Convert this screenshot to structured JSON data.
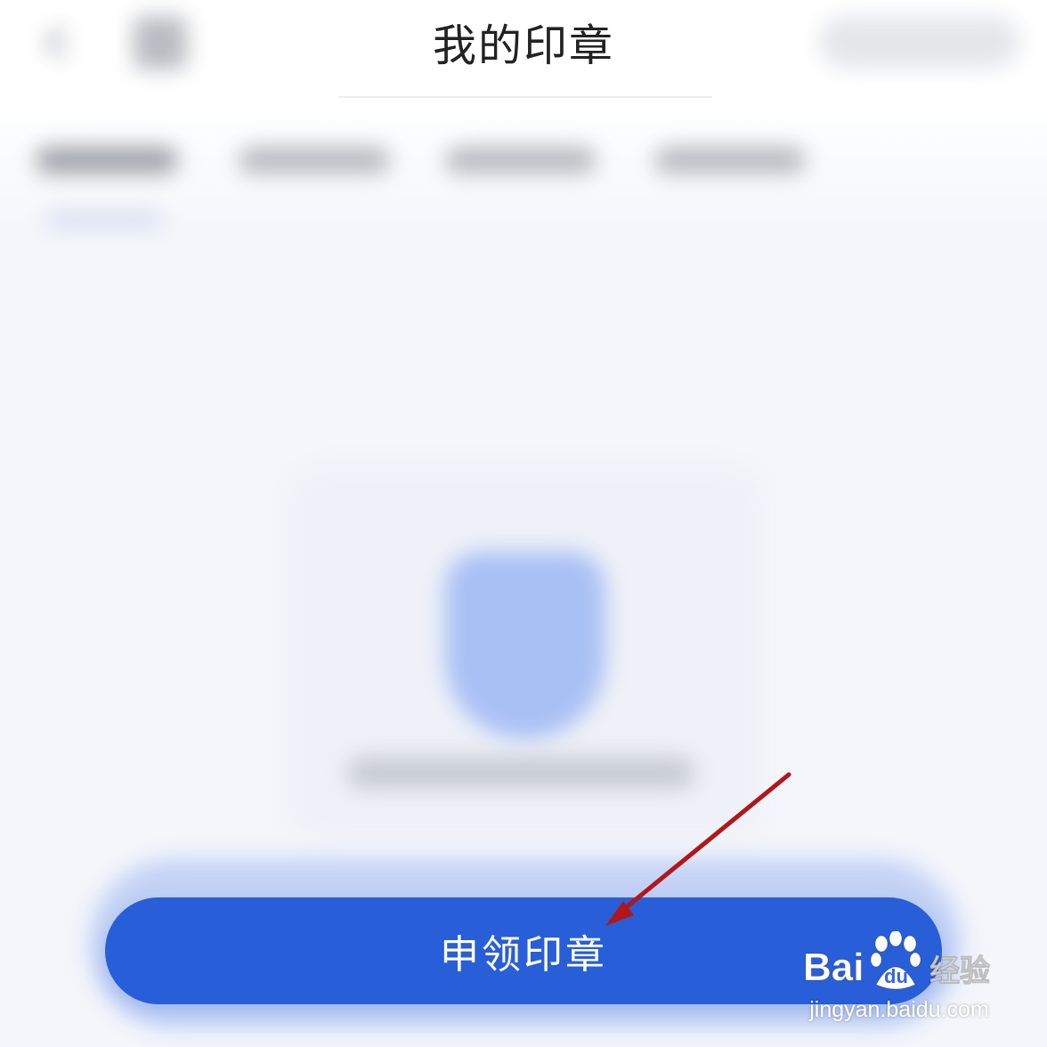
{
  "header": {
    "title": "我的印章"
  },
  "main": {
    "apply_button_label": "申领印章"
  },
  "annotation": {
    "arrow_color": "#b3161a"
  },
  "colors": {
    "primary": "#285ed8",
    "shield": "#a9c0f5",
    "background": "#f3f6fb"
  },
  "watermark": {
    "brand": "Baidu经验",
    "url": "jingyan.baidu.com"
  }
}
